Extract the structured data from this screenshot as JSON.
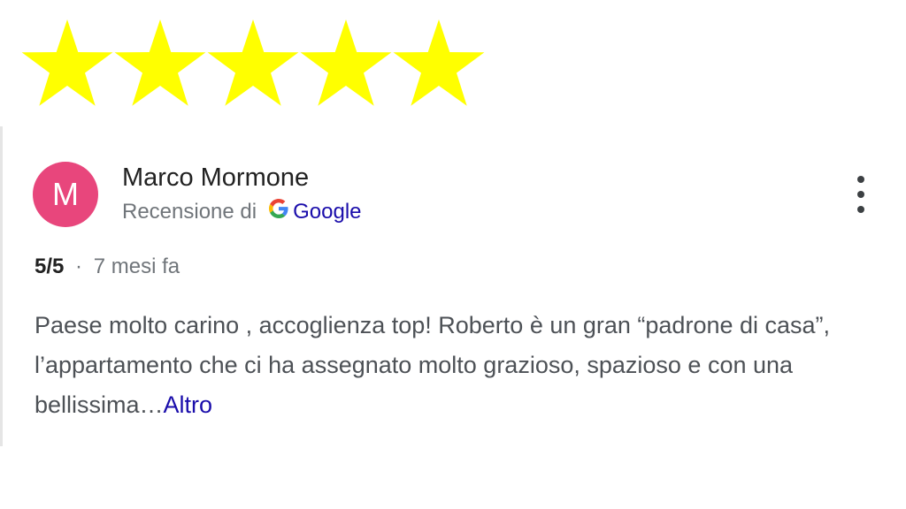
{
  "rating_stars": {
    "count": 5,
    "filled": 5,
    "color": "#ffff00",
    "icon": "star-icon"
  },
  "review": {
    "avatar_letter": "M",
    "avatar_color": "#e8467c",
    "author": "Marco Mormone",
    "source_prefix": "Recensione di",
    "source_icon": "google-g-icon",
    "source_name": "Google",
    "menu_icon": "more-vert-icon",
    "score": "5/5",
    "separator": "·",
    "time_ago": "7 mesi fa",
    "text": "Paese molto carino , accoglienza top! Roberto è un gran “padrone di casa”, l’appartamento che ci ha assegnato molto grazioso, spazioso e con una bellissima…",
    "more_label": "Altro"
  }
}
